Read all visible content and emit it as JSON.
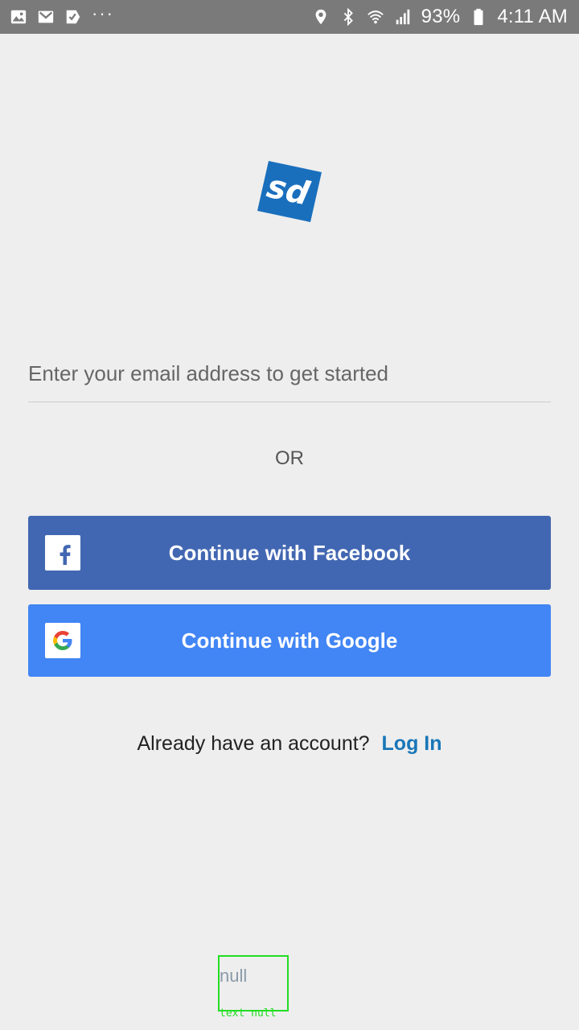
{
  "status_bar": {
    "battery": "93%",
    "time": "4:11 AM",
    "left_icons": [
      "image-icon",
      "gmail-icon",
      "tasks-icon",
      "more-dots-icon"
    ],
    "right_icons": [
      "location-icon",
      "bluetooth-icon",
      "wifi-icon",
      "signal-icon",
      "battery-icon"
    ]
  },
  "logo": {
    "text": "sd",
    "color": "#1a6fbd"
  },
  "email": {
    "placeholder": "Enter your email address to get started",
    "value": ""
  },
  "divider_text": "OR",
  "facebook_button": {
    "label": "Continue with Facebook",
    "color": "#4267b2"
  },
  "google_button": {
    "label": "Continue with Google",
    "color": "#4285f4"
  },
  "login": {
    "prompt": "Already have an account?",
    "link": "Log In",
    "link_color": "#1976b8"
  },
  "debug_overlay": {
    "text": "null",
    "tag": "text null"
  }
}
